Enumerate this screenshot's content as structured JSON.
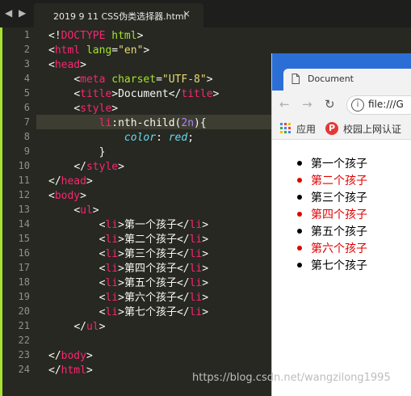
{
  "editor": {
    "tab_title": "2019 9 11 CSS伪类选择器.html",
    "tab_close": "×",
    "nav": "◀ ▶",
    "line_numbers": [
      "1",
      "2",
      "3",
      "4",
      "5",
      "6",
      "7",
      "8",
      "9",
      "10",
      "11",
      "12",
      "13",
      "14",
      "15",
      "16",
      "17",
      "18",
      "19",
      "20",
      "21",
      "22",
      "23",
      "24"
    ],
    "li_items": [
      "第一个孩子",
      "第二个孩子",
      "第三个孩子",
      "第四个孩子",
      "第五个孩子",
      "第六个孩子",
      "第七个孩子"
    ],
    "tokens": {
      "doctype_open": "<!",
      "doctype_kw": "DOCTYPE",
      "html_tag": "html",
      "head_tag": "head",
      "meta_tag": "meta",
      "title_tag": "title",
      "style_tag": "style",
      "body_tag": "body",
      "ul_tag": "ul",
      "li_tag": "li",
      "lang_attr": "lang",
      "lang_val": "\"en\"",
      "charset_attr": "charset",
      "charset_val": "\"UTF-8\"",
      "title_text": "Document",
      "selector_li": "li",
      "pseudo": ":nth-child(",
      "pseudo_arg": "2n",
      "pseudo_close": "){",
      "prop": "color",
      "colon": ": ",
      "prop_val": "red",
      "semicolon": ";",
      "brace_close": "}"
    }
  },
  "browser": {
    "tab_title": "Document",
    "back_icon": "←",
    "forward_icon": "→",
    "reload_icon": "↻",
    "info_icon": "i",
    "url": "file:///G",
    "bookmark_apps": "应用",
    "bookmark_p_icon": "P",
    "bookmark_campus": "校园上网认证",
    "list": [
      {
        "text": "第一个孩子",
        "color": "#000000"
      },
      {
        "text": "第二个孩子",
        "color": "#e00000"
      },
      {
        "text": "第三个孩子",
        "color": "#000000"
      },
      {
        "text": "第四个孩子",
        "color": "#e00000"
      },
      {
        "text": "第五个孩子",
        "color": "#000000"
      },
      {
        "text": "第六个孩子",
        "color": "#e00000"
      },
      {
        "text": "第七个孩子",
        "color": "#000000"
      }
    ]
  },
  "watermark": "https://blog.csdn.net/wangzilong1995",
  "colors": {
    "editor_bg": "#272822",
    "tag": "#f92672",
    "attr": "#a6e22e",
    "string": "#e6db74",
    "keyword": "#66d9ef",
    "number": "#ae81ff",
    "browser_titlebar": "#2b6fd6",
    "odd_child": "#e00000"
  }
}
